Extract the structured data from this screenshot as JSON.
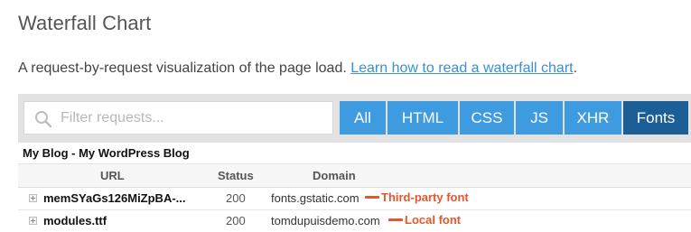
{
  "page": {
    "title": "Waterfall Chart",
    "description": "A request-by-request visualization of the page load.",
    "learn_link": "Learn how to read a waterfall chart",
    "description_end": "."
  },
  "search": {
    "placeholder": "Filter requests...",
    "icon": "search-icon"
  },
  "filters": [
    {
      "label": "All",
      "active": false
    },
    {
      "label": "HTML",
      "active": false
    },
    {
      "label": "CSS",
      "active": false
    },
    {
      "label": "JS",
      "active": false
    },
    {
      "label": "XHR",
      "active": false
    },
    {
      "label": "Fonts",
      "active": true
    }
  ],
  "colors": {
    "filter_button": "#3f9be0",
    "filter_active": "#1c5f96",
    "annotation": "#e4572e",
    "link": "#3a8fd6"
  },
  "site_title": "My Blog - My WordPress Blog",
  "table": {
    "headers": {
      "url": "URL",
      "status": "Status",
      "domain": "Domain"
    },
    "rows": [
      {
        "url": "memSYaGs126MiZpBA-...",
        "status": "200",
        "domain": "fonts.gstatic.com",
        "annotation": "Third-party font"
      },
      {
        "url": "modules.ttf",
        "status": "200",
        "domain": "tomdupuisdemo.com",
        "annotation": "Local font"
      }
    ]
  }
}
